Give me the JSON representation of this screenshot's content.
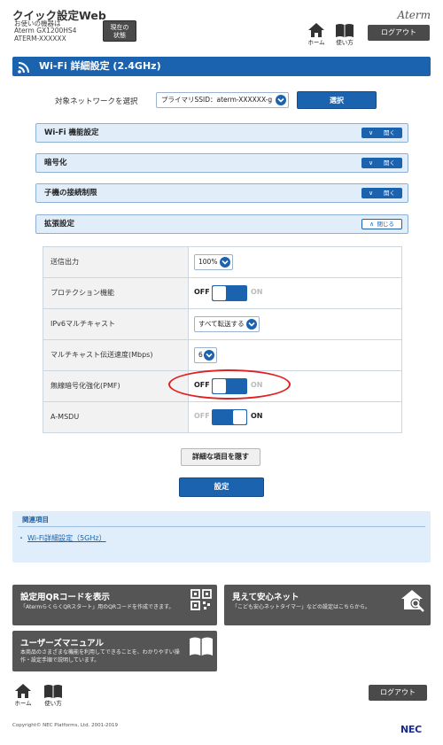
{
  "header": {
    "title": "クイック設定Web",
    "device_label": "お使いの機器は",
    "model": "Aterm GX1200HS4",
    "ssid": "ATERM-XXXXXX",
    "status_button_line1": "現在の",
    "status_button_line2": "状態",
    "brand": "Aterm",
    "nav_home": "ホーム",
    "nav_guide": "使い方",
    "logout": "ログアウト"
  },
  "page": {
    "title": "Wi-Fi 詳細設定 (2.4GHz)"
  },
  "network": {
    "label": "対象ネットワークを選択",
    "selected": "プライマリSSID：aterm-XXXXXX-g",
    "select_button": "選択"
  },
  "sections": [
    {
      "label": "Wi-Fi 機能設定",
      "button": "開く"
    },
    {
      "label": "暗号化",
      "button": "開く"
    },
    {
      "label": "子機の接続制限",
      "button": "開く"
    },
    {
      "label": "拡張設定",
      "button": "閉じる"
    }
  ],
  "settings": {
    "tx_power": {
      "label": "送信出力",
      "value": "100%"
    },
    "protection": {
      "label": "プロテクション機能",
      "off": "OFF",
      "on": "ON",
      "state": "off"
    },
    "ipv6_multicast": {
      "label": "IPv6マルチキャスト",
      "value": "すべて転送する"
    },
    "multicast_rate": {
      "label": "マルチキャスト伝送速度(Mbps)",
      "value": "6"
    },
    "pmf": {
      "label": "無線暗号化強化(PMF)",
      "off": "OFF",
      "on": "ON",
      "state": "off"
    },
    "amsdu": {
      "label": "A-MSDU",
      "off": "OFF",
      "on": "ON",
      "state": "on"
    }
  },
  "actions": {
    "hide_details": "詳細な項目を隠す",
    "apply": "設定"
  },
  "related": {
    "title": "関連項目",
    "link": "Wi-Fi詳細設定（5GHz）"
  },
  "tiles": {
    "qr": {
      "title": "設定用QRコードを表示",
      "desc": "「AtermらくらくQRスタート」用のQRコードを作成できます。"
    },
    "safe": {
      "title": "見えて安心ネット",
      "desc": "「こども安心ネットタイマー」などの設定はこちらから。"
    },
    "manual": {
      "title": "ユーザーズマニュアル",
      "desc_line1": "本商品のさまざまな機能を利用してできることを、わかりやすい操",
      "desc_line2": "作・設定手順で説明しています。"
    }
  },
  "footer": {
    "nav_home": "ホーム",
    "nav_guide": "使い方",
    "logout": "ログアウト",
    "copyright": "Copyright© NEC Platforms, Ltd. 2001-2019",
    "brand": "NEC"
  }
}
